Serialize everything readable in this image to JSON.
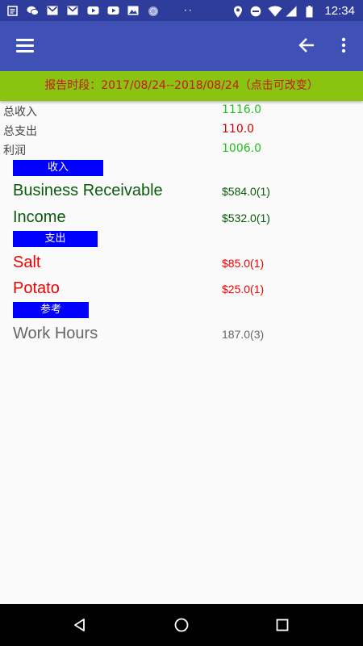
{
  "status_bar": {
    "time": "12:34",
    "dots": "··",
    "icons": [
      "notes-icon",
      "wechat-icon",
      "gmail-icon",
      "gmail-icon",
      "youtube-icon",
      "youtube-icon",
      "photo-icon",
      "sync-icon",
      "location-icon",
      "do-not-disturb-icon",
      "wifi-icon",
      "signal-icon",
      "battery-icon"
    ]
  },
  "app_bar": {
    "background": "#3f51b5",
    "icons": [
      "menu-icon",
      "back-arrow-icon",
      "overflow-menu-icon"
    ]
  },
  "period_banner": {
    "text": "报告时段：2017/08/24--2018/08/24（点击可改变）",
    "background": "#8bc311",
    "color": "#c41a1a"
  },
  "summary": {
    "income_label": "总收入",
    "income_value": "1116.0",
    "expense_label": "总支出",
    "expense_value": "110.0",
    "profit_label": "利润",
    "profit_value": "1006.0"
  },
  "sections": {
    "income_header": "收入",
    "expense_header": "支出",
    "reference_header": "参考"
  },
  "income_entries": [
    {
      "name": "Business Receivable",
      "amount": "$584.0(1)"
    },
    {
      "name": "Income",
      "amount": "$532.0(1)"
    }
  ],
  "expense_entries": [
    {
      "name": "Salt",
      "amount": "$85.0(1)"
    },
    {
      "name": "Potato",
      "amount": "$25.0(1)"
    }
  ],
  "reference_entries": [
    {
      "name": "Work Hours",
      "amount": "187.0(3)"
    }
  ],
  "colors": {
    "income_green": "#1fbf1f",
    "expense_red": "#cc0000",
    "income_entry": "#0b5a0b",
    "expense_entry": "#ee0000",
    "reference_entry": "#666666",
    "section_blue": "#0000ff"
  },
  "nav_bar": {
    "icons": [
      "back-triangle-icon",
      "home-circle-icon",
      "recents-square-icon"
    ]
  }
}
